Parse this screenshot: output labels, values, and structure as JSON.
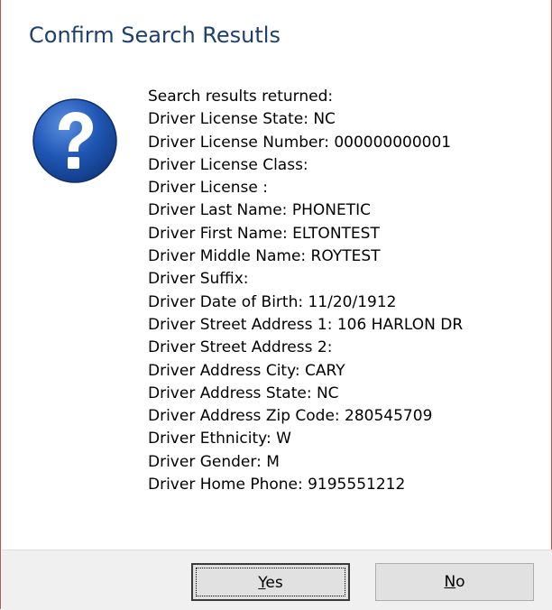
{
  "dialog": {
    "title": "Confirm Search Resutls",
    "icon": "question-icon"
  },
  "message": {
    "lines": [
      "Search results returned:",
      "Driver License State:  NC",
      "Driver License Number:  000000000001",
      "Driver License Class:",
      "Driver License :",
      "Driver Last Name:  PHONETIC",
      "Driver First Name:  ELTONTEST",
      "Driver Middle Name:  ROYTEST",
      "Driver Suffix:",
      "Driver Date of Birth:  11/20/1912",
      "Driver Street Address 1:  106 HARLON DR",
      "Driver Street Address 2:",
      "Driver Address City:  CARY",
      "Driver Address State:  NC",
      "Driver Address Zip Code:  280545709",
      "Driver Ethnicity:  W",
      "Driver Gender:  M",
      "Driver Home Phone:  9195551212"
    ]
  },
  "buttons": {
    "yes": {
      "mnemonic": "Y",
      "rest": "es"
    },
    "no": {
      "mnemonic": "N",
      "rest": "o"
    }
  },
  "colors": {
    "title": "#1f3f6e",
    "border": "#c8504b",
    "footer": "#f0f0f0",
    "icon_blue": "#1a4f9c"
  }
}
